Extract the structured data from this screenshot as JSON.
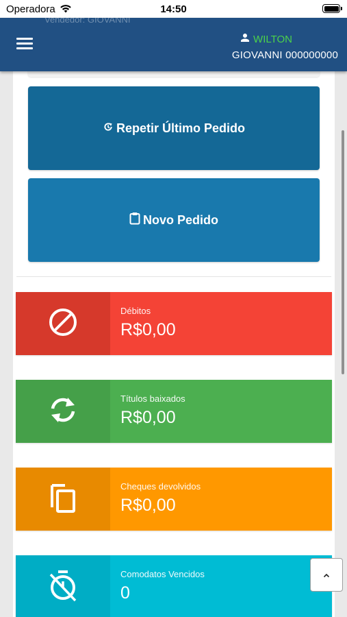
{
  "status_bar": {
    "carrier": "Operadora",
    "time": "14:50"
  },
  "header": {
    "ghost_text": "Vendedor: GIOVANNI",
    "user_name": "WILTON",
    "user_subtitle": "GIOVANNI 000000000"
  },
  "actions": [
    {
      "label": "Repetir Último Pedido",
      "icon": "history-icon"
    },
    {
      "label": "Novo Pedido",
      "icon": "clipboard-icon"
    }
  ],
  "stats": [
    {
      "label": "Débitos",
      "value": "R$0,00",
      "icon": "block-icon",
      "icon_bg": "#d6392b",
      "bg": "#f44336"
    },
    {
      "label": "Títulos baixados",
      "value": "R$0,00",
      "icon": "sync-icon",
      "icon_bg": "#45a049",
      "bg": "#4caf50"
    },
    {
      "label": "Cheques devolvidos",
      "value": "R$0,00",
      "icon": "copy-icon",
      "icon_bg": "#e88a00",
      "bg": "#ff9800"
    },
    {
      "label": "Comodatos Vencidos",
      "value": "0",
      "icon": "timer-off-icon",
      "icon_bg": "#00adc5",
      "bg": "#00bcd4"
    }
  ],
  "colors": {
    "header": "#215083",
    "user_name": "#4cd24a",
    "repeat_button": "#146896",
    "new_button": "#1979ad"
  }
}
